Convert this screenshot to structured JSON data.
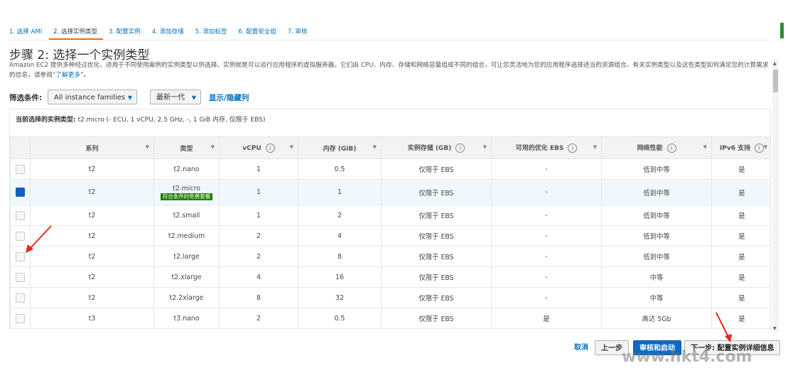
{
  "steps": [
    "1. 选择 AMI",
    "2. 选择实例类型",
    "3. 配置实例",
    "4. 添加存储",
    "5. 添加标签",
    "6. 配置安全组",
    "7. 审核"
  ],
  "page_title": "步骤 2: 选择一个实例类型",
  "description": "Amazon EC2 提供多种经过优化，适用于不同使用案例的实例类型以供选择。实例就是可以运行应用程序的虚拟服务器。它们由 CPU、内存、存储和网络容量组成不同的组合，可让您灵活地为您的应用程序选择适当的资源组合。有关实例类型以及这些类型如何满足您的计算需求的信息，请参阅“",
  "description_link": "了解更多",
  "description_end": "”。",
  "filter": {
    "label": "筛选条件:",
    "family": "All instance families",
    "generation": "最新一代",
    "toggle_columns": "显示/隐藏列"
  },
  "current_selection": {
    "label": "当前选择的实例类型:",
    "value": "t2.micro (- ECU, 1 vCPU, 2.5 GHz, -, 1 GiB 内存, 仅限于 EBS)"
  },
  "table": {
    "headers": [
      "系列",
      "类型",
      "vCPU",
      "内存 (GiB)",
      "实例存储 (GB)",
      "可用的优化 EBS",
      "网络性能",
      "IPv6 支持"
    ],
    "free_tier_label": "符合条件的免费套餐",
    "rows": [
      {
        "family": "t2",
        "type": "t2.nano",
        "vcpu": "1",
        "memory": "0.5",
        "storage": "仅限于 EBS",
        "ebs": "-",
        "network": "低到中等",
        "ipv6": "是",
        "selected": false,
        "free": false
      },
      {
        "family": "t2",
        "type": "t2.micro",
        "vcpu": "1",
        "memory": "1",
        "storage": "仅限于 EBS",
        "ebs": "-",
        "network": "低到中等",
        "ipv6": "是",
        "selected": true,
        "free": true
      },
      {
        "family": "t2",
        "type": "t2.small",
        "vcpu": "1",
        "memory": "2",
        "storage": "仅限于 EBS",
        "ebs": "-",
        "network": "低到中等",
        "ipv6": "是",
        "selected": false,
        "free": false
      },
      {
        "family": "t2",
        "type": "t2.medium",
        "vcpu": "2",
        "memory": "4",
        "storage": "仅限于 EBS",
        "ebs": "-",
        "network": "低到中等",
        "ipv6": "是",
        "selected": false,
        "free": false
      },
      {
        "family": "t2",
        "type": "t2.large",
        "vcpu": "2",
        "memory": "8",
        "storage": "仅限于 EBS",
        "ebs": "-",
        "network": "低到中等",
        "ipv6": "是",
        "selected": false,
        "free": false
      },
      {
        "family": "t2",
        "type": "t2.xlarge",
        "vcpu": "4",
        "memory": "16",
        "storage": "仅限于 EBS",
        "ebs": "-",
        "network": "中等",
        "ipv6": "是",
        "selected": false,
        "free": false
      },
      {
        "family": "t2",
        "type": "t2.2xlarge",
        "vcpu": "8",
        "memory": "32",
        "storage": "仅限于 EBS",
        "ebs": "-",
        "network": "中等",
        "ipv6": "是",
        "selected": false,
        "free": false
      },
      {
        "family": "t3",
        "type": "t3.nano",
        "vcpu": "2",
        "memory": "0.5",
        "storage": "仅限于 EBS",
        "ebs": "是",
        "network": "高达 5Gb",
        "ipv6": "是",
        "selected": false,
        "free": false
      }
    ]
  },
  "footer": {
    "cancel": "取消",
    "previous": "上一步",
    "review_launch": "审核和启动",
    "next": "下一步: 配置实例详细信息"
  },
  "watermark": "www.hkt4.com",
  "colors": {
    "link": "#0073bb",
    "primary_button": "#0b6bc2",
    "free_tier": "#1d8102",
    "active_step": "#ec7211",
    "annotation": "#e8261d"
  }
}
